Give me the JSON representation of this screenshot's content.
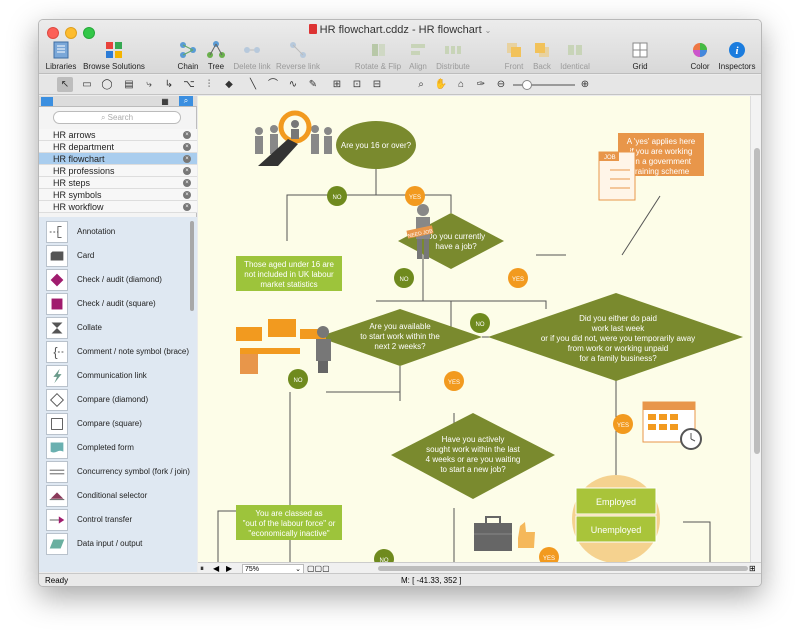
{
  "window": {
    "title": "HR flowchart.cddz - HR flowchart"
  },
  "toolbar": {
    "libraries": "Libraries",
    "browse_solutions": "Browse Solutions",
    "chain": "Chain",
    "tree": "Tree",
    "delete_link": "Delete link",
    "reverse_link": "Reverse link",
    "rotate_flip": "Rotate & Flip",
    "align": "Align",
    "distribute": "Distribute",
    "front": "Front",
    "back": "Back",
    "identical": "Identical",
    "grid": "Grid",
    "color": "Color",
    "inspectors": "Inspectors"
  },
  "sidebar": {
    "search_placeholder": "Search",
    "libraries": [
      {
        "label": "HR arrows"
      },
      {
        "label": "HR department"
      },
      {
        "label": "HR flowchart"
      },
      {
        "label": "HR professions"
      },
      {
        "label": "HR steps"
      },
      {
        "label": "HR symbols"
      },
      {
        "label": "HR workflow"
      }
    ],
    "selected_library": "HR flowchart",
    "shapes": [
      {
        "label": "Annotation"
      },
      {
        "label": "Card"
      },
      {
        "label": "Check / audit (diamond)"
      },
      {
        "label": "Check / audit (square)"
      },
      {
        "label": "Collate"
      },
      {
        "label": "Comment / note symbol (brace)"
      },
      {
        "label": "Communication link"
      },
      {
        "label": "Compare (diamond)"
      },
      {
        "label": "Compare (square)"
      },
      {
        "label": "Completed form"
      },
      {
        "label": "Concurrency symbol (fork / join)"
      },
      {
        "label": "Conditional selector"
      },
      {
        "label": "Control transfer"
      },
      {
        "label": "Data input / output"
      }
    ]
  },
  "diagram": {
    "q1": "Are you 16 or over?",
    "q2_l1": "Do you currently",
    "q2_l2": "have a job?",
    "q3_l1": "Are you available",
    "q3_l2": "to start work within the",
    "q3_l3": "next 2 weeks?",
    "q4_l1": "Did you either do paid",
    "q4_l2": "work last week",
    "q4_l3": "or if you did not, were you temporarily away",
    "q4_l4": "from work or working unpaid",
    "q4_l5": "for a family business?",
    "q5_l1": "Have you actively",
    "q5_l2": "sought work within the last",
    "q5_l3": "4 weeks or are you waiting",
    "q5_l4": "to start a new job?",
    "note_under16_l1": "Those aged under 16 are",
    "note_under16_l2": "not included in UK labour",
    "note_under16_l3": "market statistics",
    "note_yes_l1": "A 'yes' applies here",
    "note_yes_l2": "if you are working",
    "note_yes_l3": "on a government",
    "note_yes_l4": "training scheme",
    "note_inactive_l1": "You are classed as",
    "note_inactive_l2": "\"out of the labour force\" or",
    "note_inactive_l3": "\"economically inactive\"",
    "employed": "Employed",
    "unemployed": "Unemployed",
    "yes": "YES",
    "no": "NO",
    "need_job": "NEED JOB",
    "job": "JOB"
  },
  "zoom": "75%",
  "status": {
    "left": "Ready",
    "coords": "M: [ -41.33, 352 ]"
  },
  "colors": {
    "decision": "#7a8a2e",
    "yes_circle": "#f29a1f",
    "no_circle": "#6f8a1e",
    "note_green": "#9dc43b",
    "note_orange": "#e8964a",
    "result_circle": "#f5d28f",
    "result_box": "#a9c43a",
    "canvas_bg": "#fdfde8",
    "selected_library": "#a9cdee"
  }
}
